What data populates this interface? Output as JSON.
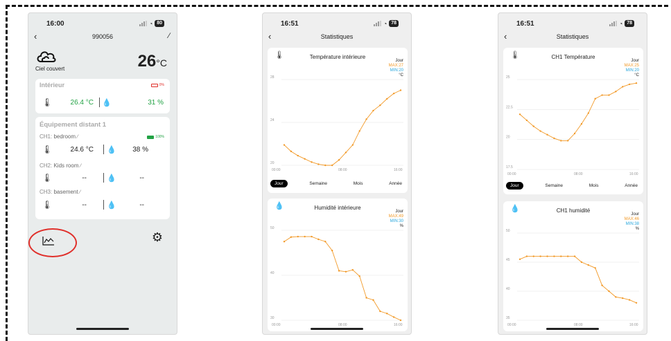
{
  "screen1": {
    "time": "16:00",
    "battery": "80",
    "title": "990056",
    "weather_label": "Ciel couvert",
    "outdoor_temp": "26",
    "outdoor_unit": "°C",
    "indoor": {
      "header": "Intérieur",
      "battery_pct": "0%",
      "temp": "26.4 °C",
      "humidity": "31 %"
    },
    "remote": {
      "header": "Équipement distant 1",
      "channels": [
        {
          "label": "CH1:",
          "name": "bedroom",
          "battery_pct": "100%",
          "temp": "24.6 °C",
          "humidity": "38 %"
        },
        {
          "label": "CH2:",
          "name": "Kids room",
          "temp": "--",
          "humidity": "--"
        },
        {
          "label": "CH3:",
          "name": "basement",
          "temp": "--",
          "humidity": "--"
        }
      ]
    },
    "icons": [
      "back-icon",
      "edit-icon",
      "cloud-icon",
      "thermometer-icon",
      "drop-icon",
      "battery-icon",
      "chart-icon",
      "gear-icon"
    ]
  },
  "screen2": {
    "time": "16:51",
    "battery": "78",
    "title": "Statistiques",
    "temp_panel": {
      "title": "Température intérieure",
      "period": "Jour",
      "max": "MAX:27",
      "min": "MIN:20",
      "unit": "°C",
      "yticks": [
        "28",
        "24",
        "20"
      ],
      "xticks": [
        "00:00",
        "08:00",
        "16:00"
      ]
    },
    "tabs": [
      "Jour",
      "Semaine",
      "Mois",
      "Année"
    ],
    "hum_panel": {
      "title": "Humidité intérieure",
      "period": "Jour",
      "max": "MAX:49",
      "min": "MIN:30",
      "unit": "%",
      "yticks": [
        "50",
        "40",
        "30"
      ],
      "xticks": [
        "00:00",
        "08:00",
        "16:00"
      ]
    }
  },
  "screen3": {
    "time": "16:51",
    "battery": "78",
    "title": "Statistiques",
    "temp_panel": {
      "title": "CH1 Température",
      "period": "Jour",
      "max": "MAX:25",
      "min": "MIN:20",
      "unit": "°C",
      "yticks": [
        "25",
        "22.5",
        "20",
        "17.5"
      ],
      "xticks": [
        "00:00",
        "08:00",
        "16:00"
      ]
    },
    "tabs": [
      "Jour",
      "Semaine",
      "Mois",
      "Année"
    ],
    "hum_panel": {
      "title": "CH1 humidité",
      "period": "Jour",
      "max": "MAX:46",
      "min": "MIN:38",
      "unit": "%",
      "yticks": [
        "50",
        "45",
        "40",
        "35"
      ],
      "xticks": [
        "00:00",
        "08:00",
        "16:00"
      ]
    }
  },
  "colors": {
    "line": "#f29a29",
    "max": "#f29a29",
    "min": "#2aa7dd",
    "annotation": "#e0302b",
    "green": "#22a244"
  },
  "chart_data": [
    {
      "type": "line",
      "title": "Température intérieure",
      "ylim": [
        20,
        28
      ],
      "x": [
        "00:00",
        "01:00",
        "02:00",
        "03:00",
        "04:00",
        "05:00",
        "06:00",
        "07:00",
        "08:00",
        "09:00",
        "10:00",
        "11:00",
        "12:00",
        "13:00",
        "14:00",
        "15:00",
        "16:00",
        "17:00"
      ],
      "series": [
        {
          "values": [
            21.9,
            21.3,
            20.9,
            20.6,
            20.3,
            20.1,
            20.0,
            20.0,
            20.5,
            21.2,
            21.9,
            23.2,
            24.3,
            25.1,
            25.6,
            26.2,
            26.7,
            27.0
          ]
        }
      ]
    },
    {
      "type": "line",
      "title": "Humidité intérieure",
      "ylim": [
        30,
        50
      ],
      "x": [
        "00:00",
        "01:00",
        "02:00",
        "03:00",
        "04:00",
        "05:00",
        "06:00",
        "07:00",
        "08:00",
        "09:00",
        "10:00",
        "11:00",
        "12:00",
        "13:00",
        "14:00",
        "15:00",
        "16:00",
        "17:00"
      ],
      "series": [
        {
          "values": [
            47.5,
            48.5,
            48.6,
            48.6,
            48.6,
            48.0,
            47.5,
            45.5,
            41.0,
            40.8,
            41.2,
            39.8,
            35.0,
            34.5,
            32.0,
            31.5,
            30.7,
            30.0
          ]
        }
      ]
    },
    {
      "type": "line",
      "title": "CH1 Température",
      "ylim": [
        17.5,
        25
      ],
      "x": [
        "00:00",
        "01:00",
        "02:00",
        "03:00",
        "04:00",
        "05:00",
        "06:00",
        "07:00",
        "08:00",
        "09:00",
        "10:00",
        "11:00",
        "12:00",
        "13:00",
        "14:00",
        "15:00",
        "16:00",
        "17:00"
      ],
      "series": [
        {
          "values": [
            22.1,
            21.6,
            21.1,
            20.7,
            20.4,
            20.1,
            19.9,
            19.9,
            20.5,
            21.3,
            22.2,
            23.4,
            23.7,
            23.7,
            24.0,
            24.4,
            24.6,
            24.7
          ]
        }
      ]
    },
    {
      "type": "line",
      "title": "CH1 humidité",
      "ylim": [
        35,
        50
      ],
      "x": [
        "00:00",
        "01:00",
        "02:00",
        "03:00",
        "04:00",
        "05:00",
        "06:00",
        "07:00",
        "08:00",
        "09:00",
        "10:00",
        "11:00",
        "12:00",
        "13:00",
        "14:00",
        "15:00",
        "16:00",
        "17:00"
      ],
      "series": [
        {
          "values": [
            45.5,
            46.0,
            46.0,
            46.0,
            46.0,
            46.0,
            46.0,
            46.0,
            46.0,
            45.0,
            44.5,
            44.0,
            41.0,
            40.0,
            39.0,
            38.8,
            38.5,
            38.0
          ]
        }
      ]
    }
  ]
}
